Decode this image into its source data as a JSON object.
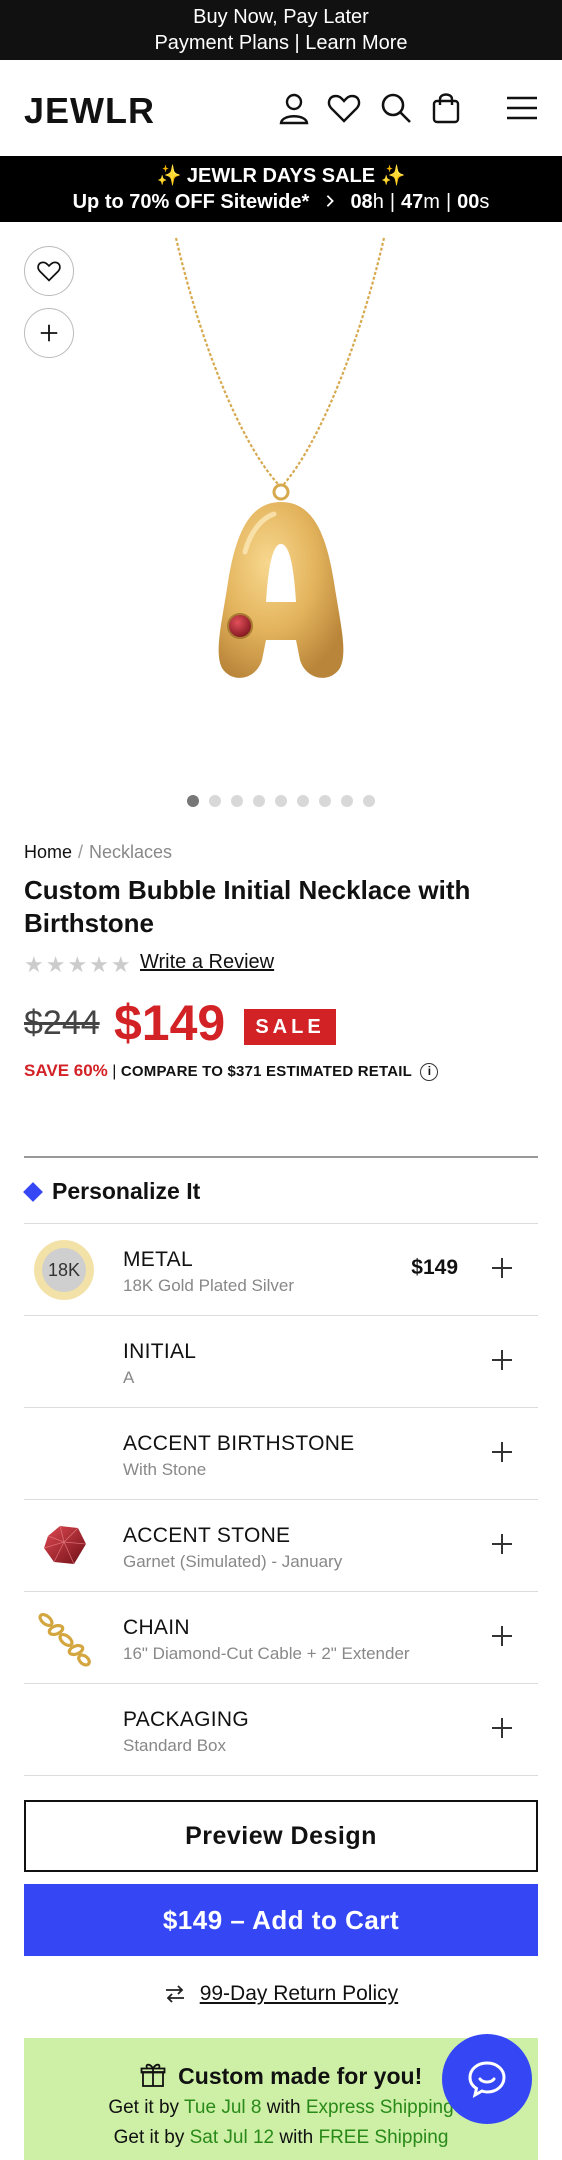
{
  "topbar": {
    "line1": "Buy Now, Pay Later",
    "line2": "Payment Plans | Learn More"
  },
  "header": {
    "logo": "JEWLR",
    "icons": [
      "account-icon",
      "wishlist-heart-icon",
      "search-icon",
      "shopping-bag-icon",
      "hamburger-menu-icon"
    ]
  },
  "promo": {
    "line1": "✨ JEWLR DAYS SALE ✨",
    "line2": "Up to 70% OFF Sitewide*",
    "countdown": {
      "hours": "08",
      "h_unit": "h",
      "minutes": "47",
      "m_unit": "m",
      "seconds": "00",
      "s_unit": "s"
    }
  },
  "gallery": {
    "slide_count": 9,
    "active_slide": 1,
    "colors": {
      "gold": "#e3b35c",
      "stone": "#9c1f28"
    }
  },
  "breadcrumb": {
    "home": "Home",
    "separator": "/",
    "current": "Necklaces"
  },
  "product": {
    "title": "Custom Bubble Initial Necklace with Birthstone",
    "rating_stars": "★★★★★",
    "rating_value": 0,
    "review_link": "Write a Review",
    "old_price": "$244",
    "price": "$149",
    "sale_badge": "SALE",
    "save_text": "SAVE 60%",
    "compare_text": "COMPARE TO $371 ESTIMATED RETAIL",
    "info_glyph": "i"
  },
  "personalize": {
    "heading": "Personalize It",
    "options": [
      {
        "label": "METAL",
        "value": "18K Gold Plated Silver",
        "price": "$149",
        "thumb_text": "18K"
      },
      {
        "label": "INITIAL",
        "value": "A"
      },
      {
        "label": "ACCENT BIRTHSTONE",
        "value": "With Stone"
      },
      {
        "label": "ACCENT STONE",
        "value": "Garnet (Simulated) - January"
      },
      {
        "label": "CHAIN",
        "value": "16\" Diamond-Cut Cable + 2\" Extender"
      },
      {
        "label": "PACKAGING",
        "value": "Standard Box"
      }
    ]
  },
  "actions": {
    "preview": "Preview Design",
    "add_to_cart": "$149 – Add to Cart"
  },
  "returns": {
    "label": "99-Day Return Policy"
  },
  "shipping": {
    "title": "Custom made for you!",
    "express": {
      "prefix": "Get it by ",
      "date": "Tue Jul 8",
      "mid": " with ",
      "method": "Express Shipping"
    },
    "free": {
      "prefix": "Get it by ",
      "date": "Sat Jul 12",
      "mid": " with ",
      "method": "FREE Shipping"
    }
  },
  "colors": {
    "accent": "#3546f5",
    "sale": "#d32226",
    "ship_bg": "#cdf0a6",
    "ship_green": "#2a8a19"
  }
}
